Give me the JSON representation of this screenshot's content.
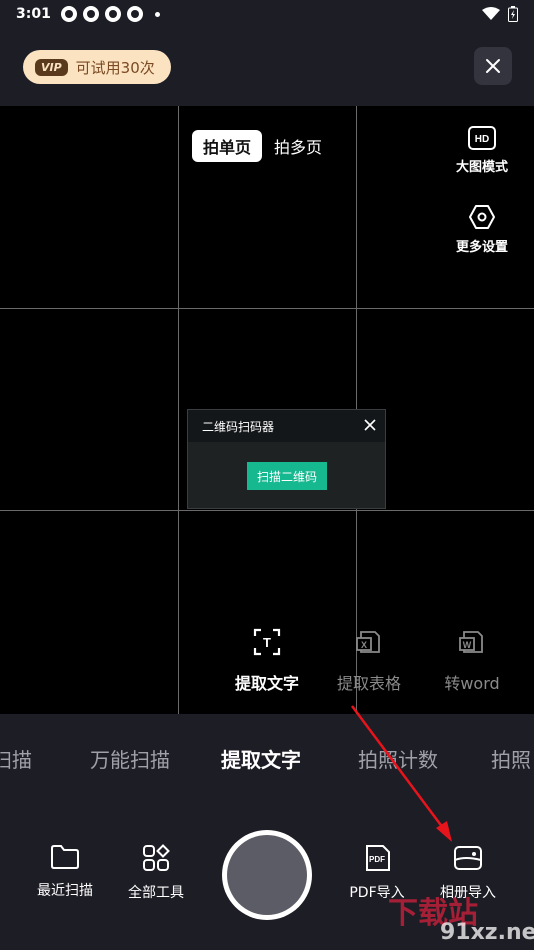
{
  "status_bar": {
    "time": "3:01"
  },
  "top_bar": {
    "vip_badge": "VIP",
    "trial_text": "可试用30次"
  },
  "camera": {
    "page_toggle": {
      "single": "拍单页",
      "multi": "拍多页"
    },
    "side_tools": {
      "hd_label": "大图模式",
      "hd_icon_text": "HD",
      "settings_label": "更多设置"
    },
    "qr_popup": {
      "title": "二维码扫码器",
      "button": "扫描二维码"
    },
    "sub_modes": [
      {
        "label": "提取文字",
        "icon": "text-extract-icon",
        "icon_text": "T",
        "color": "#ffffff"
      },
      {
        "label": "提取表格",
        "icon": "excel-icon",
        "icon_text": "X",
        "color": "#8a8a8a"
      },
      {
        "label": "转word",
        "icon": "word-icon",
        "icon_text": "W",
        "color": "#8a8a8a"
      }
    ]
  },
  "mode_strip": {
    "items": [
      "扫描",
      "万能扫描",
      "提取文字",
      "拍照计数",
      "拍照"
    ],
    "active": "提取文字"
  },
  "bottom_bar": {
    "recent_scan": "最近扫描",
    "all_tools": "全部工具",
    "pdf_import": "PDF导入",
    "pdf_icon_text": "PDF",
    "album_import": "相册导入"
  },
  "watermark": {
    "main": "下载站",
    "sub": "91xz.net"
  },
  "colors": {
    "accent_green": "#16b88f",
    "vip_pill": "#fbe3c2",
    "background": "#1d1d26",
    "arrow": "#e8141c"
  }
}
